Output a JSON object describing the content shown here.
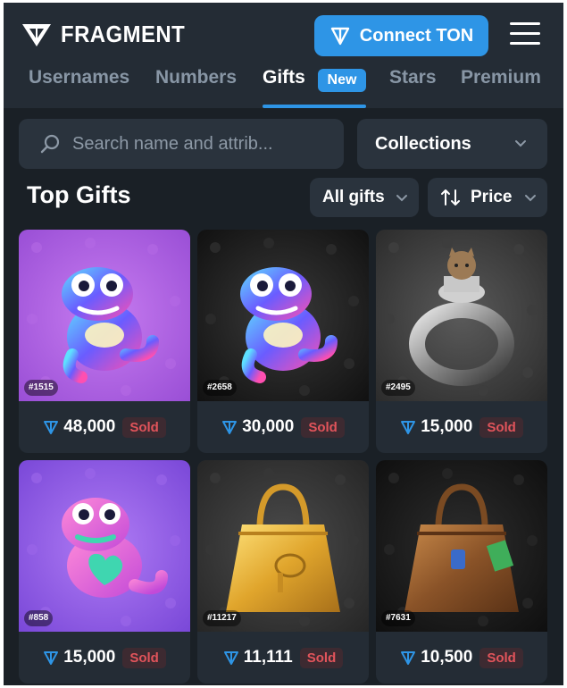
{
  "header": {
    "logo_text": "FRAGMENT",
    "connect_label": "Connect TON",
    "accent_color": "#2e95e6"
  },
  "tabs": [
    {
      "label": "Usernames"
    },
    {
      "label": "Numbers"
    },
    {
      "label": "Gifts",
      "active": true,
      "badge": "New"
    },
    {
      "label": "Stars"
    },
    {
      "label": "Premium"
    }
  ],
  "search": {
    "placeholder": "Search name and attrib..."
  },
  "collections": {
    "label": "Collections"
  },
  "section_title": "Top Gifts",
  "filters": {
    "all_gifts": "All gifts",
    "sort": "Price"
  },
  "gifts": [
    {
      "number": "#1515",
      "price": "48,000",
      "status": "Sold",
      "item": "plush-pepe",
      "background": "purple"
    },
    {
      "number": "#2658",
      "price": "30,000",
      "status": "Sold",
      "item": "plush-pepe",
      "background": "black"
    },
    {
      "number": "#2495",
      "price": "15,000",
      "status": "Sold",
      "item": "ring-with-cat",
      "background": "gray"
    },
    {
      "number": "#858",
      "price": "15,000",
      "status": "Sold",
      "item": "pink-pepe-with-heart",
      "background": "violet"
    },
    {
      "number": "#11217",
      "price": "11,111",
      "status": "Sold",
      "item": "gold-handbag",
      "background": "gray"
    },
    {
      "number": "#7631",
      "price": "10,500",
      "status": "Sold",
      "item": "brown-handbag",
      "background": "black"
    }
  ]
}
